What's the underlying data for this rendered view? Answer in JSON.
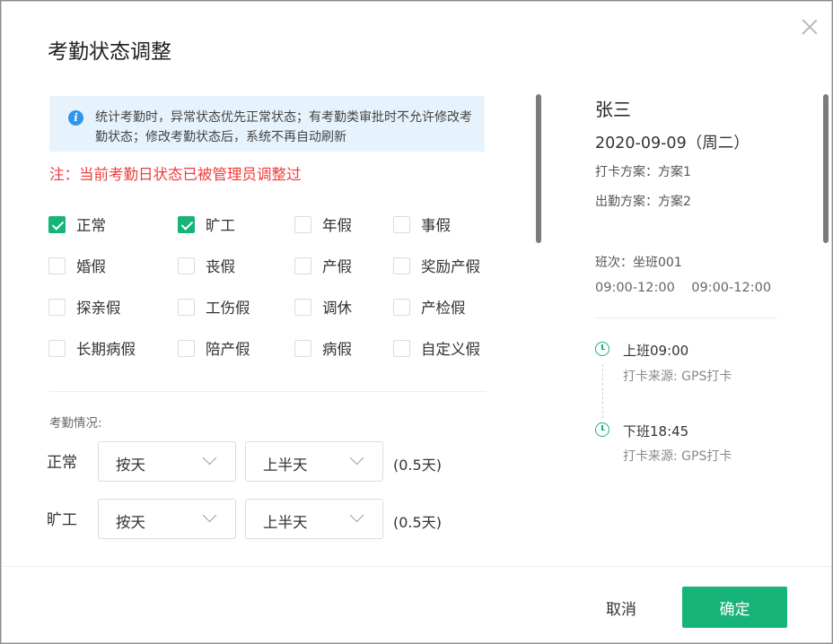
{
  "dialog": {
    "title": "考勤状态调整",
    "info_text": "统计考勤时，异常状态优先正常状态；有考勤类审批时不允许修改考勤状态；修改考勤状态后，系统不再自动刷新",
    "warning": "注：当前考勤日状态已被管理员调整过",
    "statuses": [
      {
        "label": "正常",
        "checked": true
      },
      {
        "label": "旷工",
        "checked": true
      },
      {
        "label": "年假",
        "checked": false
      },
      {
        "label": "事假",
        "checked": false
      },
      {
        "label": "婚假",
        "checked": false
      },
      {
        "label": "丧假",
        "checked": false
      },
      {
        "label": "产假",
        "checked": false
      },
      {
        "label": "奖励产假",
        "checked": false
      },
      {
        "label": "探亲假",
        "checked": false
      },
      {
        "label": "工伤假",
        "checked": false
      },
      {
        "label": "调休",
        "checked": false
      },
      {
        "label": "产检假",
        "checked": false
      },
      {
        "label": "长期病假",
        "checked": false
      },
      {
        "label": "陪产假",
        "checked": false
      },
      {
        "label": "病假",
        "checked": false
      },
      {
        "label": "自定义假",
        "checked": false
      }
    ],
    "situation_label": "考勤情况:",
    "rows": [
      {
        "label": "正常",
        "unit": "按天",
        "period": "上半天",
        "days": "(0.5天)"
      },
      {
        "label": "旷工",
        "unit": "按天",
        "period": "上半天",
        "days": "(0.5天)"
      }
    ],
    "cancel_label": "取消",
    "confirm_label": "确定"
  },
  "person": {
    "name": "张三",
    "date": "2020-09-09（周二）",
    "clock_plan": "打卡方案：方案1",
    "attendance_plan": "出勤方案：方案2",
    "shift": "班次：坐班001",
    "times": "09:00-12:00    09:00-12:00",
    "timeline": [
      {
        "title": "上班09:00",
        "source": "打卡来源: GPS打卡"
      },
      {
        "title": "下班18:45",
        "source": "打卡来源: GPS打卡"
      }
    ]
  },
  "colors": {
    "accent": "#17b47a",
    "warning": "#f03c3c",
    "info_bg": "#e6f3fc",
    "info_icon": "#2f96ea"
  },
  "icons": [
    "close-icon",
    "info-icon",
    "check-icon",
    "chevron-down-icon",
    "clock-icon"
  ]
}
